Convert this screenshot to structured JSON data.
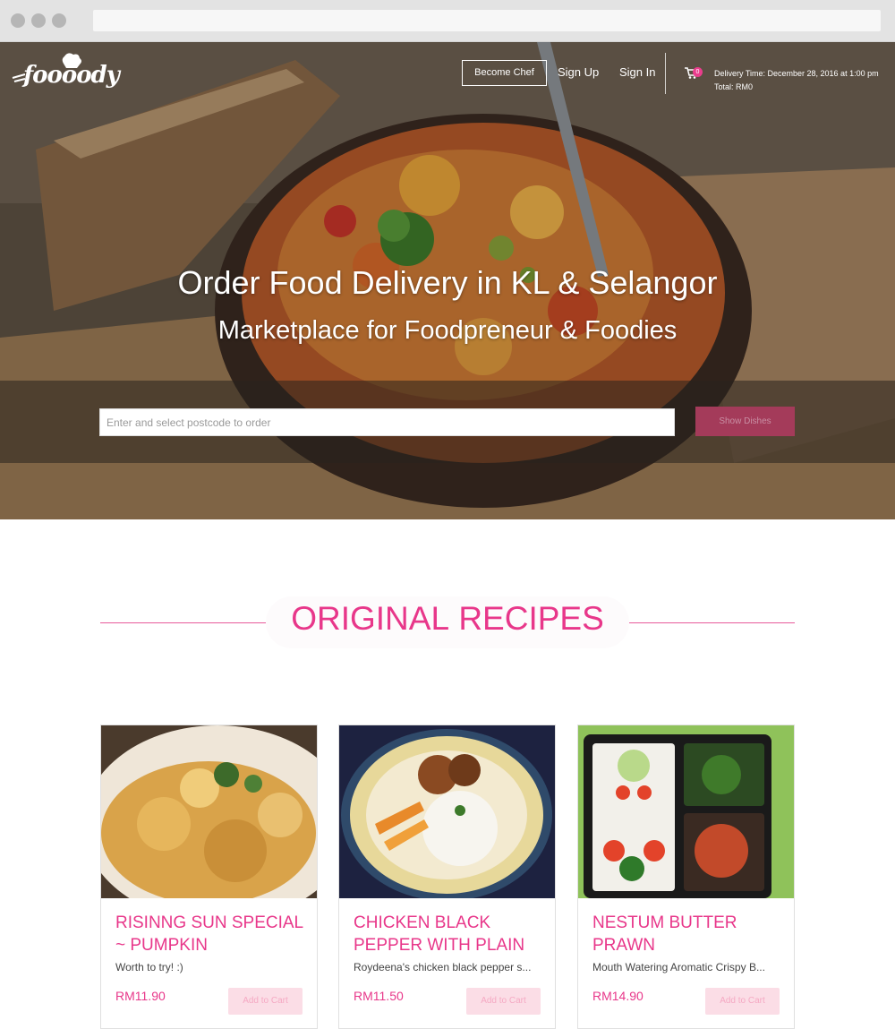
{
  "brand": {
    "logo_text": "foooody"
  },
  "nav": {
    "become_chef": "Become Chef",
    "sign_up": "Sign Up",
    "sign_in": "Sign In",
    "cart_count": "0",
    "delivery_time": "Delivery Time: December 28, 2016 at 1:00 pm",
    "total": "Total: RM0"
  },
  "hero": {
    "title": "Order Food Delivery in KL & Selangor",
    "subtitle": "Marketplace for Foodpreneur & Foodies",
    "search_placeholder": "Enter and select postcode to order",
    "show_dishes": "Show Dishes"
  },
  "section": {
    "title_strong": "ORIGINAL",
    "title_rest": " RECIPES"
  },
  "cards": [
    {
      "title": "RISINNG SUN SPECIAL ~ PUMPKIN",
      "desc": "Worth to try! :)",
      "price": "RM11.90",
      "button": "Add to Cart"
    },
    {
      "title": "CHICKEN BLACK PEPPER WITH PLAIN",
      "desc": "Roydeena's chicken black pepper s...",
      "price": "RM11.50",
      "button": "Add to Cart"
    },
    {
      "title": "NESTUM BUTTER PRAWN",
      "desc": "Mouth Watering Aromatic Crispy B...",
      "price": "RM14.90",
      "button": "Add to Cart"
    }
  ],
  "colors": {
    "accent": "#e8378a",
    "button_dark": "#a43b5a",
    "button_light": "#fbdde6"
  }
}
